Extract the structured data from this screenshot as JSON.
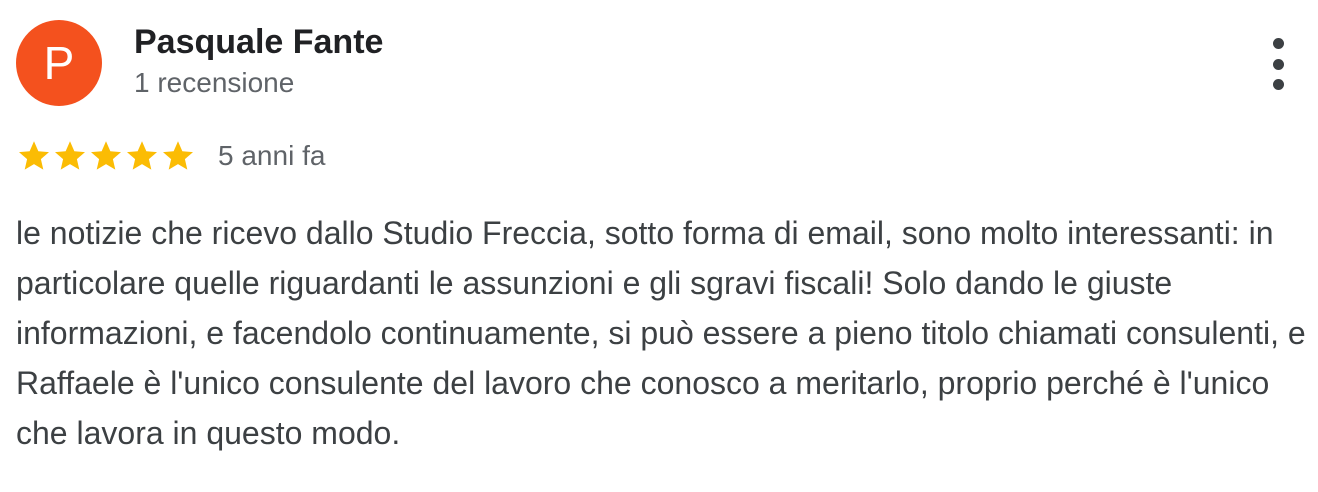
{
  "review": {
    "avatar_initial": "P",
    "author_name": "Pasquale Fante",
    "author_meta": "1 recensione",
    "rating": 5,
    "rating_max": 5,
    "time_ago": "5 anni fa",
    "text": "le notizie che ricevo dallo Studio Freccia, sotto forma di email, sono molto interessanti: in particolare quelle riguardanti le assunzioni e gli sgravi fiscali! Solo dando le giuste informazioni, e facendolo continuamente, si può essere a pieno titolo chiamati consulenti, e Raffaele è l'unico consulente del lavoro che conosco a meritarlo, proprio perché è l'unico che lavora in questo modo.",
    "menu_icon": "more-vert-icon",
    "star_icon": "star-icon"
  },
  "colors": {
    "avatar_bg": "#f4511e",
    "star": "#fbbc04",
    "name": "#202124",
    "meta": "#5f6368",
    "body": "#3c4043"
  }
}
